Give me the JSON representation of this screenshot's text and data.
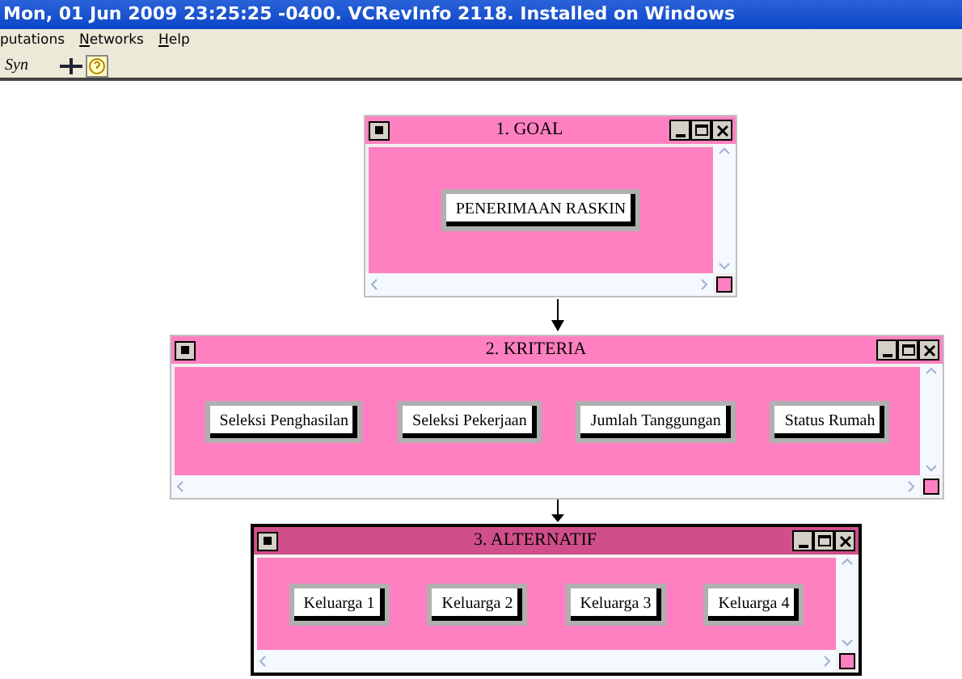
{
  "window": {
    "title": "Mon, 01 Jun 2009 23:25:25 -0400.  VCRevInfo 2118.  Installed on Windows"
  },
  "menu": [
    {
      "label": "putations",
      "mnemonic": false
    },
    {
      "label": "Networks",
      "mnemonic": true
    },
    {
      "label": "Help",
      "mnemonic": true
    }
  ],
  "toolbar": {
    "label": "Syn"
  },
  "windows": [
    {
      "title": "1. GOAL",
      "active": false,
      "items": [
        "PENERIMAAN RASKIN"
      ]
    },
    {
      "title": "2. KRITERIA",
      "active": false,
      "items": [
        "Seleksi Penghasilan",
        "Seleksi Pekerjaan",
        "Jumlah Tanggungan",
        "Status Rumah"
      ]
    },
    {
      "title": "3. ALTERNATIF",
      "active": true,
      "items": [
        "Keluarga 1",
        "Keluarga 2",
        "Keluarga 3",
        "Keluarga 4"
      ]
    }
  ]
}
